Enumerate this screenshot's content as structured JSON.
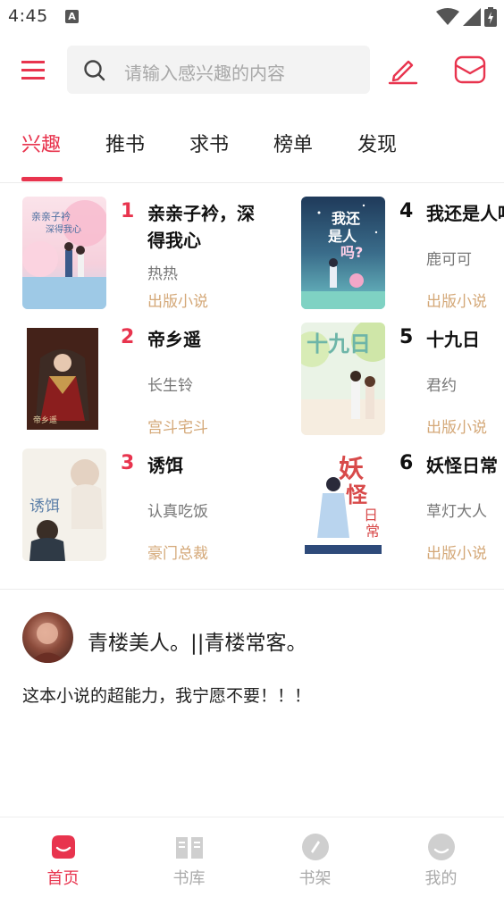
{
  "status_bar": {
    "time": "4:45",
    "notif_letter": "A"
  },
  "search": {
    "placeholder": "请输入感兴趣的内容"
  },
  "tabs": [
    {
      "label": "兴趣",
      "active": true
    },
    {
      "label": "推书",
      "active": false
    },
    {
      "label": "求书",
      "active": false
    },
    {
      "label": "榜单",
      "active": false
    },
    {
      "label": "发现",
      "active": false
    }
  ],
  "books": [
    {
      "rank": "1",
      "title": "亲亲子衿，深得我心",
      "author": "热热",
      "genre": "出版小说",
      "rank_color": "#e8344e"
    },
    {
      "rank": "2",
      "title": "帝乡遥",
      "author": "长生铃",
      "genre": "宫斗宅斗",
      "rank_color": "#e8344e"
    },
    {
      "rank": "3",
      "title": "诱饵",
      "author": "认真吃饭",
      "genre": "豪门总裁",
      "rank_color": "#e8344e"
    },
    {
      "rank": "4",
      "title": "我还是人吗",
      "author": "鹿可可",
      "genre": "出版小说",
      "rank_color": "#111111"
    },
    {
      "rank": "5",
      "title": "十九日",
      "author": "君约",
      "genre": "出版小说",
      "rank_color": "#111111"
    },
    {
      "rank": "6",
      "title": "妖怪日常",
      "author": "草灯大人",
      "genre": "出版小说",
      "rank_color": "#111111"
    }
  ],
  "post": {
    "username": "青楼美人。||青楼常客。",
    "content": "这本小说的超能力，我宁愿不要！！！"
  },
  "bottom_nav": [
    {
      "label": "首页",
      "icon": "home-icon",
      "active": true
    },
    {
      "label": "书库",
      "icon": "library-icon",
      "active": false
    },
    {
      "label": "书架",
      "icon": "bookshelf-icon",
      "active": false
    },
    {
      "label": "我的",
      "icon": "profile-icon",
      "active": false
    }
  ],
  "colors": {
    "accent": "#e8344e",
    "genre": "#d4a878"
  }
}
